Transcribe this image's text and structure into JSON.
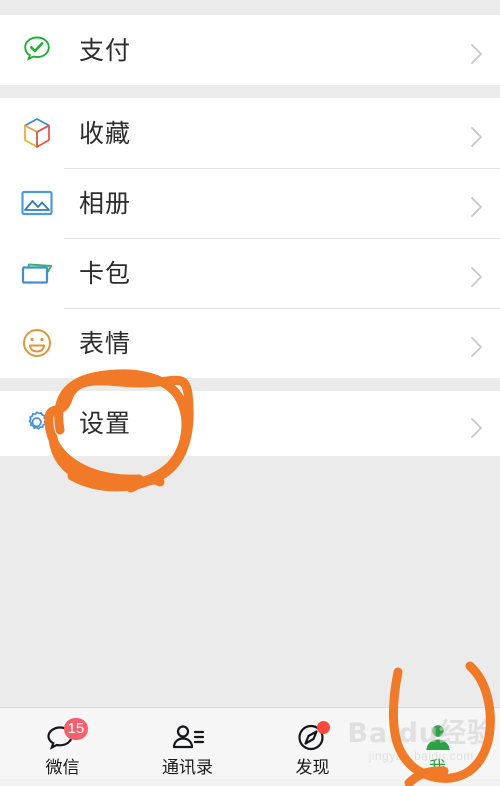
{
  "app": {
    "name": "WeChat",
    "screen": "me",
    "background_gray": "#ebebeb",
    "row_background": "#ffffff",
    "accent_green": "#2ba245",
    "annotation_color": "#f07a28",
    "badge_color": "#f4606c",
    "dot_color": "#fa4a40"
  },
  "list": {
    "groups": [
      {
        "id": "group-pay",
        "items": [
          {
            "id": "pay",
            "label": "支付",
            "icon": "wechat-pay-icon",
            "icon_color": "#22ac38",
            "chevron": "chevron-right-icon"
          }
        ]
      },
      {
        "id": "group-main",
        "items": [
          {
            "id": "favorites",
            "label": "收藏",
            "icon": "cube-favorites-icon",
            "icon_color": "#3c8ed0",
            "chevron": "chevron-right-icon"
          },
          {
            "id": "album",
            "label": "相册",
            "icon": "photo-album-icon",
            "icon_color": "#3c8ed0",
            "chevron": "chevron-right-icon"
          },
          {
            "id": "cards",
            "label": "卡包",
            "icon": "card-wallet-icon",
            "icon_color": "#3f8fd4",
            "chevron": "chevron-right-icon"
          },
          {
            "id": "stickers",
            "label": "表情",
            "icon": "smiley-emoji-icon",
            "icon_color": "#d79a3e",
            "chevron": "chevron-right-icon"
          }
        ]
      },
      {
        "id": "group-settings",
        "items": [
          {
            "id": "settings",
            "label": "设置",
            "icon": "gear-settings-icon",
            "icon_color": "#4a90d9",
            "chevron": "chevron-right-icon"
          }
        ]
      }
    ]
  },
  "annotations": [
    {
      "id": "settings-circle",
      "type": "hand-drawn-ellipse",
      "target": "设置",
      "color": "#f07a28"
    },
    {
      "id": "me-tab-circle",
      "type": "hand-drawn-ellipse",
      "target": "我",
      "color": "#f07a28"
    }
  ],
  "tabbar": {
    "tabs": [
      {
        "id": "chats",
        "label": "微信",
        "icon": "chat-bubble-icon",
        "badge": "15",
        "badge_type": "count",
        "active": false
      },
      {
        "id": "contacts",
        "label": "通讯录",
        "icon": "contacts-person-icon",
        "badge": "",
        "badge_type": "none",
        "active": false
      },
      {
        "id": "discover",
        "label": "发现",
        "icon": "compass-discover-icon",
        "badge": "",
        "badge_type": "dot",
        "active": false
      },
      {
        "id": "me",
        "label": "我",
        "icon": "person-me-icon",
        "badge": "",
        "badge_type": "none",
        "active": true
      }
    ]
  },
  "watermark": {
    "main": "Baidu经验",
    "sub": "jingyan.baidu.com"
  }
}
